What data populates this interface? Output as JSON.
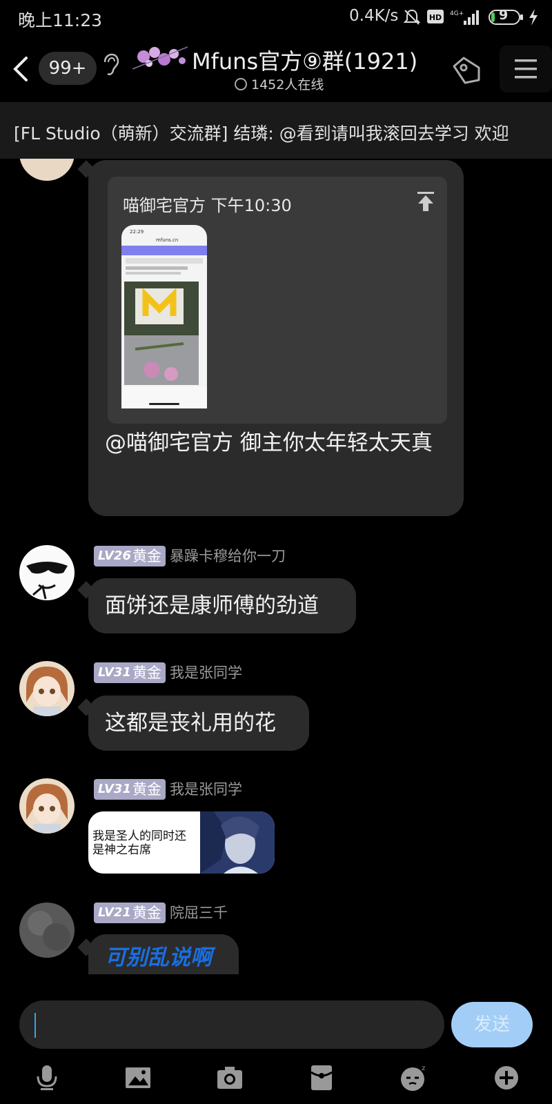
{
  "status_bar": {
    "time": "晚上11:23",
    "net_speed": "0.4K/s",
    "battery": "9"
  },
  "header": {
    "badge": "99+",
    "group_title": "Mfuns官方⑨群(1921)",
    "online_count": "1452人在线"
  },
  "announcement": "[FL Studio（萌新）交流群] 结璘: @看到请叫我滚回去学习 欢迎",
  "quoted": {
    "author_time": "喵御宅官方 下午10:30",
    "reply_text": "@喵御宅官方 御主你太年轻太天真"
  },
  "messages": [
    {
      "level": "LV26",
      "rank": "黄金",
      "nickname": "暴躁卡穆给你一刀",
      "text": "面饼还是康师傅的劲道"
    },
    {
      "level": "LV31",
      "rank": "黄金",
      "nickname": "我是张同学",
      "text": "这都是丧礼用的花"
    },
    {
      "level": "LV31",
      "rank": "黄金",
      "nickname": "我是张同学",
      "sticker_text": "我是圣人的同时还是神之右席"
    },
    {
      "level": "LV21",
      "rank": "黄金",
      "nickname": "院屈三千",
      "text": "可别乱说啊"
    }
  ],
  "input": {
    "send_label": "发送"
  },
  "colors": {
    "bubble": "#2b2b2b",
    "level_badge": "#a9a8c6",
    "send_button": "#a2cdf6",
    "blue_text": "#1a6fe0"
  }
}
